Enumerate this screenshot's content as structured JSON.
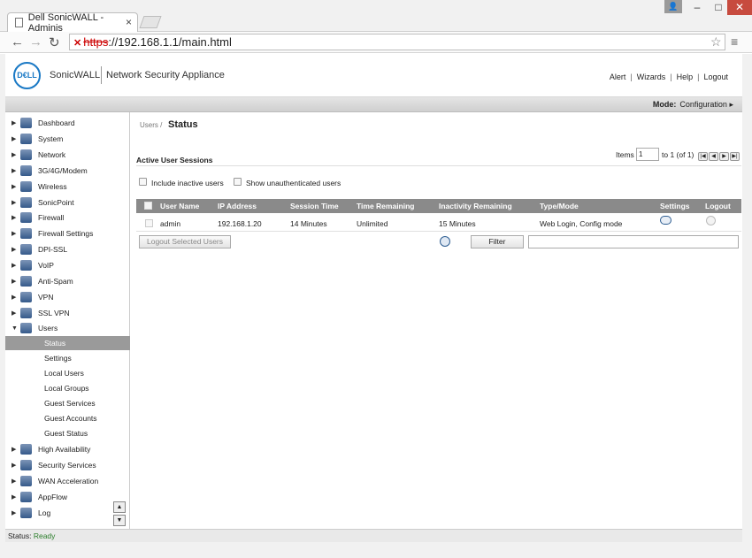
{
  "browser": {
    "tab_title": "Dell SonicWALL - Adminis",
    "tab_close": "×",
    "url_scheme": "https",
    "url_rest": "://192.168.1.1/main.html"
  },
  "header": {
    "logo_text": "D€LL",
    "brand": "SonicWALL",
    "product": "Network Security Appliance",
    "links": [
      "Alert",
      "Wizards",
      "Help",
      "Logout"
    ],
    "mode_label": "Mode:",
    "mode_value": "Configuration"
  },
  "sidebar": {
    "items": [
      {
        "label": "Dashboard",
        "icon": "dashboard-icon"
      },
      {
        "label": "System",
        "icon": "system-icon"
      },
      {
        "label": "Network",
        "icon": "network-icon"
      },
      {
        "label": "3G/4G/Modem",
        "icon": "modem-icon"
      },
      {
        "label": "Wireless",
        "icon": "wireless-icon"
      },
      {
        "label": "SonicPoint",
        "icon": "sonicpoint-icon"
      },
      {
        "label": "Firewall",
        "icon": "firewall-icon"
      },
      {
        "label": "Firewall Settings",
        "icon": "firewall-settings-icon"
      },
      {
        "label": "DPI-SSL",
        "icon": "dpi-ssl-icon"
      },
      {
        "label": "VoIP",
        "icon": "voip-icon"
      },
      {
        "label": "Anti-Spam",
        "icon": "anti-spam-icon"
      },
      {
        "label": "VPN",
        "icon": "vpn-icon"
      },
      {
        "label": "SSL VPN",
        "icon": "ssl-vpn-icon"
      },
      {
        "label": "Users",
        "icon": "users-icon"
      }
    ],
    "users_sub": [
      "Status",
      "Settings",
      "Local Users",
      "Local Groups",
      "Guest Services",
      "Guest Accounts",
      "Guest Status"
    ],
    "bottom_items": [
      {
        "label": "High Availability",
        "icon": "high-availability-icon"
      },
      {
        "label": "Security Services",
        "icon": "security-services-icon"
      },
      {
        "label": "WAN Acceleration",
        "icon": "wan-acceleration-icon"
      },
      {
        "label": "AppFlow",
        "icon": "appflow-icon"
      },
      {
        "label": "Log",
        "icon": "log-icon"
      }
    ]
  },
  "main": {
    "breadcrumb": "Users /",
    "title": "Status",
    "items_label": "Items",
    "items_value": "1",
    "items_range": "to 1 (of 1)",
    "section_title": "Active User Sessions",
    "include_inactive": "Include inactive users",
    "show_unauthenticated": "Show unauthenticated users",
    "columns": [
      "User Name",
      "IP Address",
      "Session Time",
      "Time Remaining",
      "Inactivity Remaining",
      "Type/Mode",
      "Settings",
      "Logout"
    ],
    "rows": [
      {
        "user": "admin",
        "ip": "192.168.1.20",
        "session": "14 Minutes",
        "remaining": "Unlimited",
        "inactivity": "15 Minutes",
        "type": "Web Login, Config mode"
      }
    ],
    "logout_selected": "Logout Selected Users",
    "filter": "Filter"
  },
  "status": {
    "label": "Status:",
    "value": "Ready"
  }
}
